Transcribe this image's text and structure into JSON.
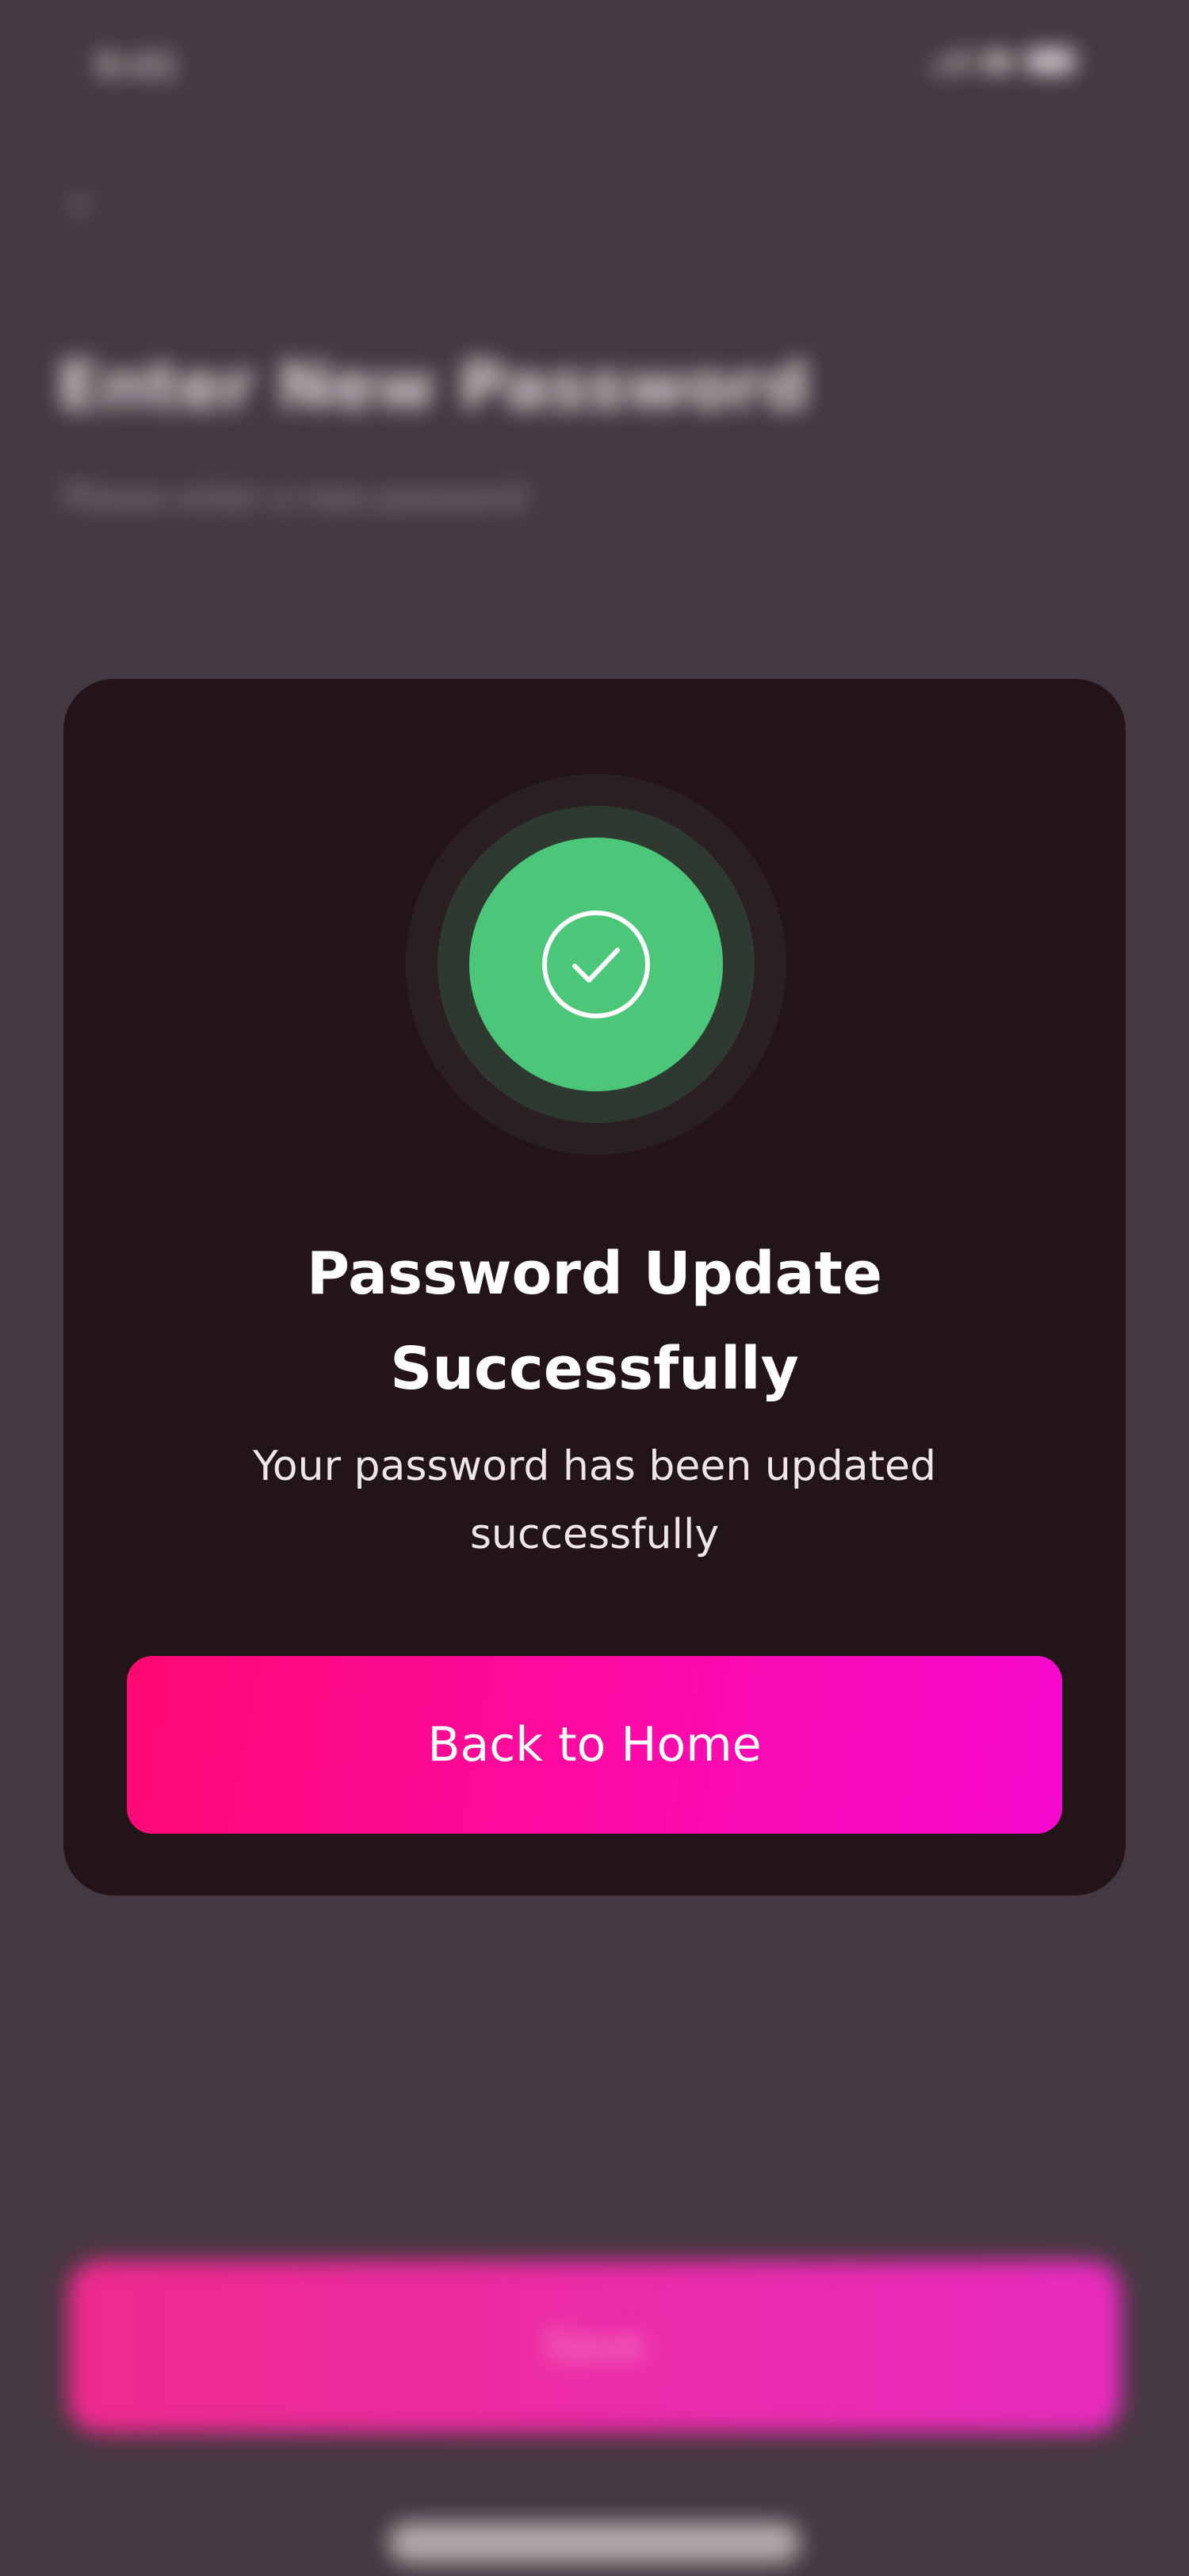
{
  "background": {
    "status_bar": {
      "time": "9:41",
      "icons": [
        "signal-icon",
        "wifi-icon",
        "battery-icon"
      ]
    },
    "back_icon": "arrow-left-icon",
    "title": "Enter New Password",
    "subtitle": "Please enter a new password",
    "primary_button_label": "Save"
  },
  "modal": {
    "icon": "check-circle-icon",
    "title": "Password Update Successfully",
    "message": "Your password has been updated successfully",
    "button_label": "Back to Home"
  },
  "colors": {
    "overlay_background": "#463840",
    "modal_background": "#231419",
    "success_green": "#4cc77a",
    "button_gradient_start": "#ff0a73",
    "button_gradient_end": "#f70ad0",
    "text_primary": "#ffffff"
  }
}
